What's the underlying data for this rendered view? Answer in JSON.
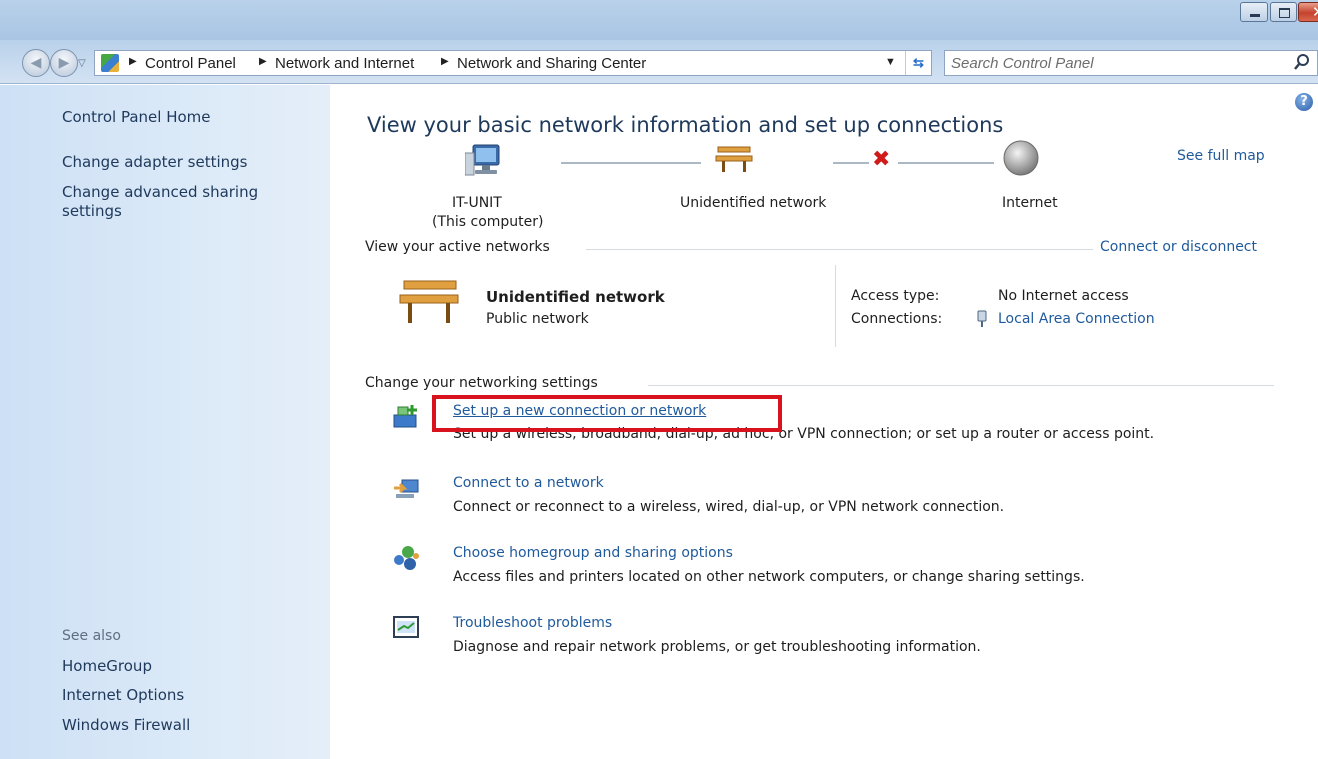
{
  "window": {
    "close_glyph": "✕"
  },
  "nav": {
    "breadcrumb": [
      "Control Panel",
      "Network and Internet",
      "Network and Sharing Center"
    ],
    "search_placeholder": "Search Control Panel",
    "icons": [
      "back-arrow-icon",
      "forward-arrow-icon",
      "control-panel-icon",
      "refresh-icon",
      "search-icon"
    ]
  },
  "sidebar": {
    "items": [
      {
        "label": "Control Panel Home"
      },
      {
        "label": "Change adapter settings"
      },
      {
        "label": "Change advanced sharing settings"
      }
    ],
    "see_also_label": "See also",
    "see_also": [
      {
        "label": "HomeGroup"
      },
      {
        "label": "Internet Options"
      },
      {
        "label": "Windows Firewall"
      }
    ]
  },
  "main": {
    "title": "View your basic network information and set up connections",
    "see_full_map": "See full map",
    "map": {
      "computer_name": "IT-UNIT",
      "computer_sub": "(This computer)",
      "network_name": "Unidentified network",
      "internet_label": "Internet",
      "broken_link_glyph": "✖"
    },
    "active_networks": {
      "heading": "View your active networks",
      "action": "Connect or disconnect",
      "network_name": "Unidentified network",
      "network_type": "Public network",
      "access_type_label": "Access type:",
      "access_type_value": "No Internet access",
      "connections_label": "Connections:",
      "connection_value": "Local Area Connection"
    },
    "settings": {
      "heading": "Change your networking settings",
      "tasks": [
        {
          "title": "Set up a new connection or network",
          "desc": "Set up a wireless, broadband, dial-up, ad hoc, or VPN connection; or set up a router or access point.",
          "icon": "new-connection-icon",
          "highlighted": true
        },
        {
          "title": "Connect to a network",
          "desc": "Connect or reconnect to a wireless, wired, dial-up, or VPN network connection.",
          "icon": "connect-network-icon"
        },
        {
          "title": "Choose homegroup and sharing options",
          "desc": "Access files and printers located on other network computers, or change sharing settings.",
          "icon": "homegroup-icon"
        },
        {
          "title": "Troubleshoot problems",
          "desc": "Diagnose and repair network problems, or get troubleshooting information.",
          "icon": "troubleshoot-icon"
        }
      ]
    },
    "help_glyph": "?"
  },
  "colors": {
    "link": "#1f5a9b",
    "highlight": "#d8131e",
    "sidebar_bg": "#dceaf8"
  }
}
